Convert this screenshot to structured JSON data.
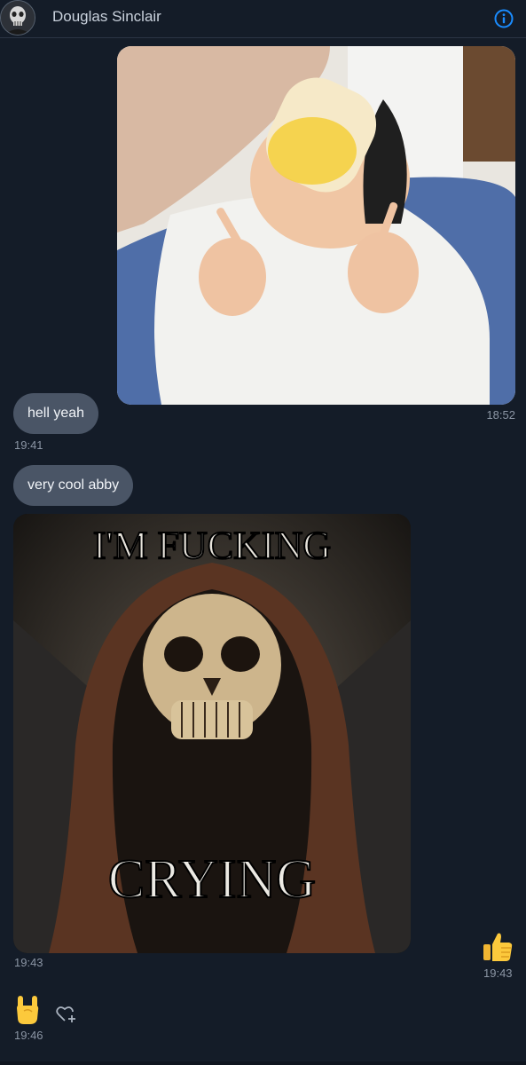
{
  "header": {
    "contact_name": "Douglas Sinclair",
    "info_icon": "info-circle-icon",
    "accent_color": "#1a8cff"
  },
  "messages": [
    {
      "type": "image",
      "side": "right",
      "description_icon": "baby-photo",
      "time": "18:52"
    },
    {
      "type": "text",
      "side": "left",
      "text": "hell yeah",
      "time": "19:41"
    },
    {
      "type": "text",
      "side": "left",
      "text": "very cool abby"
    },
    {
      "type": "image",
      "side": "left",
      "top_caption": "I'M FUCKING",
      "bottom_caption": "CRYING",
      "time": "19:43"
    },
    {
      "type": "emoji",
      "side": "right",
      "icon": "thumbs-up-icon",
      "time": "19:43"
    },
    {
      "type": "emoji",
      "side": "left",
      "icon": "rock-on-hand-icon",
      "time": "19:46",
      "react_icon": "add-reaction-heart-icon"
    }
  ]
}
